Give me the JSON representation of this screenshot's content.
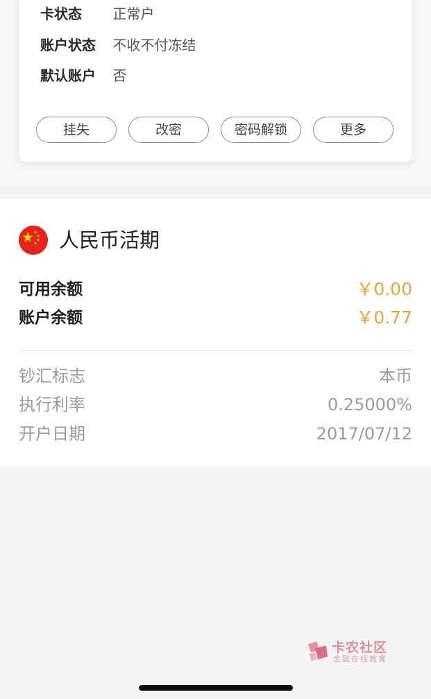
{
  "card": {
    "rows": [
      {
        "label": "卡状态",
        "value": "正常户"
      },
      {
        "label": "账户状态",
        "value": "不收不付冻结"
      },
      {
        "label": "默认账户",
        "value": "否"
      }
    ],
    "buttons": [
      "挂失",
      "改密",
      "密码解锁",
      "更多"
    ]
  },
  "account": {
    "title": "人民币活期",
    "flag_icon": "china-flag-icon",
    "balances": [
      {
        "label": "可用余额",
        "value": "￥0.00"
      },
      {
        "label": "账户余额",
        "value": "￥0.77"
      }
    ],
    "details": [
      {
        "label": "钞汇标志",
        "value": "本币"
      },
      {
        "label": "执行利率",
        "value": "0.25000%"
      },
      {
        "label": "开户日期",
        "value": "2017/07/12"
      }
    ],
    "accent_color": "#e4a440"
  },
  "watermark": {
    "title": "卡农社区",
    "subtitle": "金融在线教育"
  }
}
